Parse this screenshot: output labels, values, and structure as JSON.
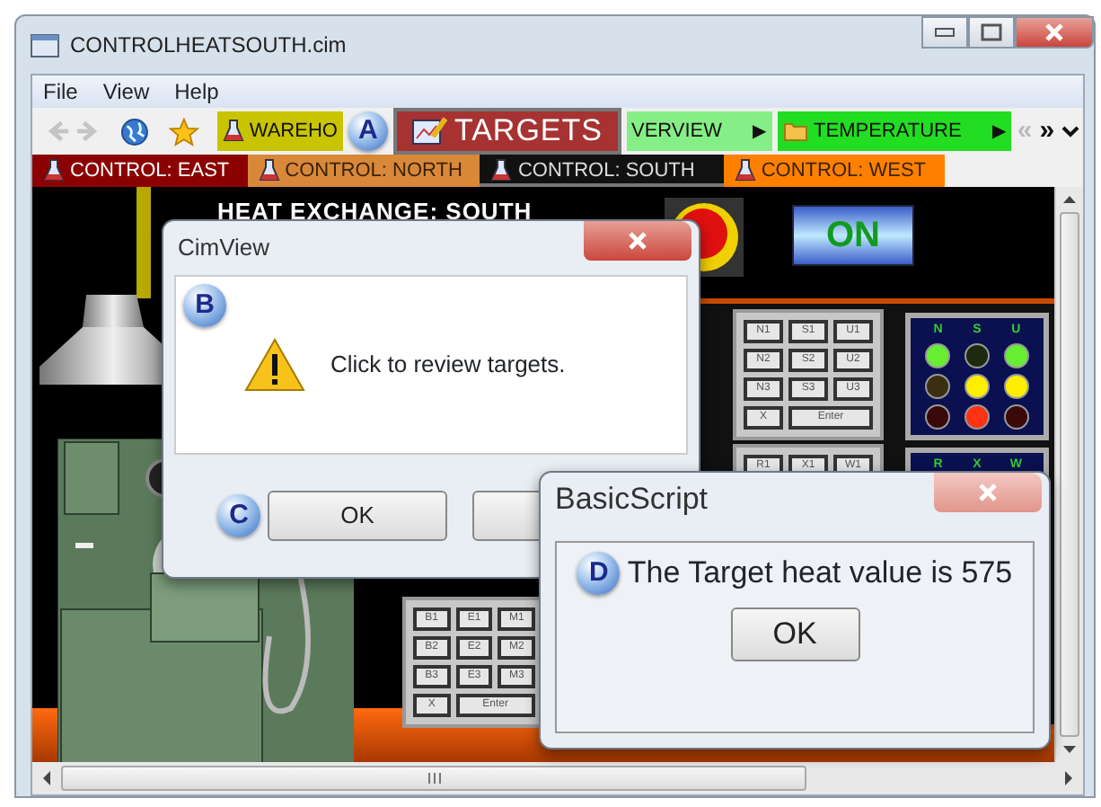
{
  "window": {
    "title": "CONTROLHEATSOUTH.cim"
  },
  "menu": [
    "File",
    "View",
    "Help"
  ],
  "toolbar": {
    "nav": [
      {
        "kind": "back",
        "disabled": true
      },
      {
        "kind": "forward",
        "disabled": true
      }
    ],
    "items": [
      {
        "kind": "link",
        "label": "WAREHO",
        "color": "#c8c400"
      },
      {
        "kind": "callout",
        "label": "A"
      },
      {
        "kind": "popup",
        "label": "TARGETS"
      },
      {
        "kind": "link",
        "label": "VERVIEW",
        "color": "#86ee86",
        "arrow": "▶"
      },
      {
        "kind": "link",
        "label": "TEMPERATURE",
        "color": "#22dd22",
        "arrow": "▶"
      }
    ],
    "scroll": [
      {
        "label": "«",
        "disabled": true
      },
      {
        "label": "»",
        "disabled": false
      }
    ]
  },
  "tabs": [
    {
      "label": "CONTROL: EAST",
      "color": "#8b0000",
      "selected": false
    },
    {
      "label": "CONTROL: NORTH",
      "color": "#d9883a",
      "selected": false
    },
    {
      "label": "CONTROL: SOUTH",
      "color": "#111111",
      "selected": true
    },
    {
      "label": "CONTROL: WEST",
      "color": "#ff8000",
      "selected": false
    }
  ],
  "canvas": {
    "title": "HEAT EXCHANGE: SOUTH",
    "switch": {
      "label": "ON",
      "on": true
    },
    "keypads": [
      {
        "keys": [
          "N1",
          "S1",
          "U1",
          "N2",
          "S2",
          "U2",
          "N3",
          "S3",
          "U3",
          "X",
          "Enter"
        ]
      },
      {
        "keys": [
          "R1",
          "X1",
          "W1"
        ]
      },
      {
        "keys": [
          "B1",
          "E1",
          "M1",
          "B2",
          "E2",
          "M2",
          "B3",
          "E3",
          "M3",
          "X",
          "Enter"
        ]
      }
    ],
    "lamp_panels": [
      {
        "labels": [
          "N",
          "S",
          "U"
        ],
        "lamps": [
          {
            "color": "#66ee33"
          },
          {
            "color": "#1e2a10"
          },
          {
            "color": "#66ee33"
          },
          {
            "color": "#3a3010"
          },
          {
            "color": "#ffee00"
          },
          {
            "color": "#ffee00"
          },
          {
            "color": "#3a0a0a"
          },
          {
            "color": "#ff3311"
          },
          {
            "color": "#3a0a0a"
          }
        ]
      },
      {
        "labels": [
          "R",
          "X",
          "W"
        ]
      }
    ]
  },
  "dialogs": [
    {
      "title": "CimView",
      "close_active": true,
      "callout": "B",
      "message": "Click to review targets.",
      "buttons": [
        {
          "label": "OK",
          "callout": "C"
        }
      ]
    },
    {
      "title": "BasicScript",
      "close_active": false,
      "callout": "D",
      "message": "The Target heat value is 575",
      "buttons": [
        {
          "label": "OK"
        }
      ]
    }
  ]
}
